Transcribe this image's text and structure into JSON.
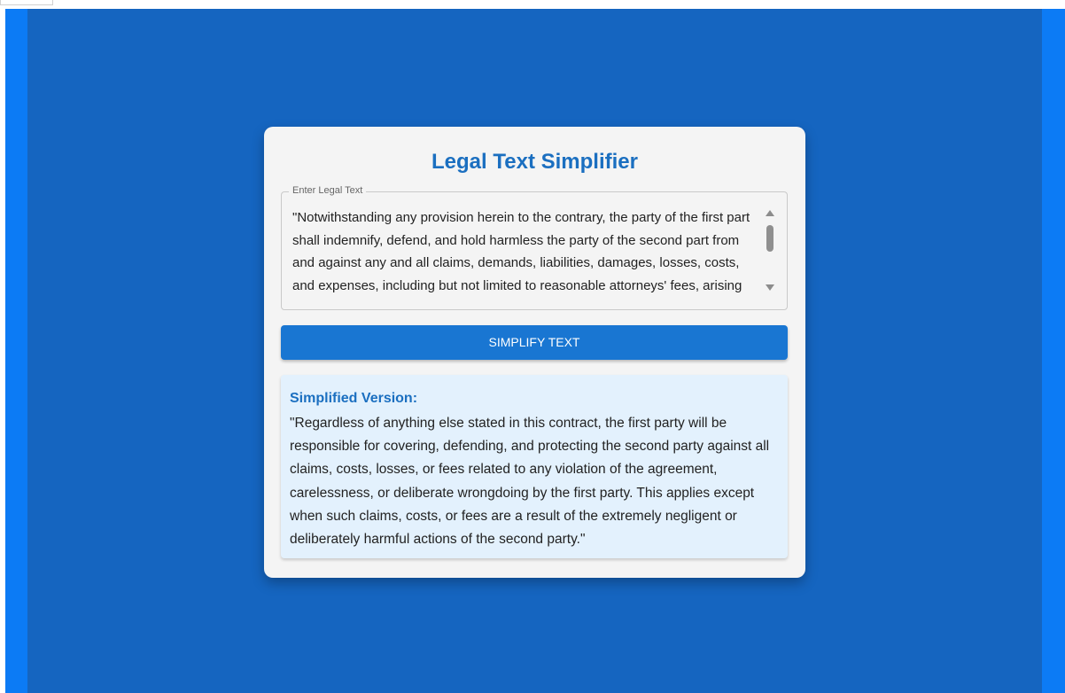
{
  "app": {
    "title": "Legal Text Simplifier"
  },
  "input": {
    "label": "Enter Legal Text",
    "value": "\"Notwithstanding any provision herein to the contrary, the party of the first part shall indemnify, defend, and hold harmless the party of the second part from and against any and all claims, demands, liabilities, damages, losses, costs, and expenses, including but not limited to reasonable attorneys' fees, arising"
  },
  "actions": {
    "simplify_label": "SIMPLIFY TEXT"
  },
  "result": {
    "title": "Simplified Version:",
    "text": "\"Regardless of anything else stated in this contract, the first party will be responsible for covering, defending, and protecting the second party against all claims, costs, losses, or fees related to any violation of the agreement, carelessness, or deliberate wrongdoing by the first party. This applies except when such claims, costs, or fees are a result of the extremely negligent or deliberately harmful actions of the second party.\""
  },
  "colors": {
    "background": "#1565c0",
    "edge": "#0c7bf5",
    "accent": "#1976d2",
    "title": "#1b6fc0",
    "result_bg": "#e3f1fd"
  }
}
